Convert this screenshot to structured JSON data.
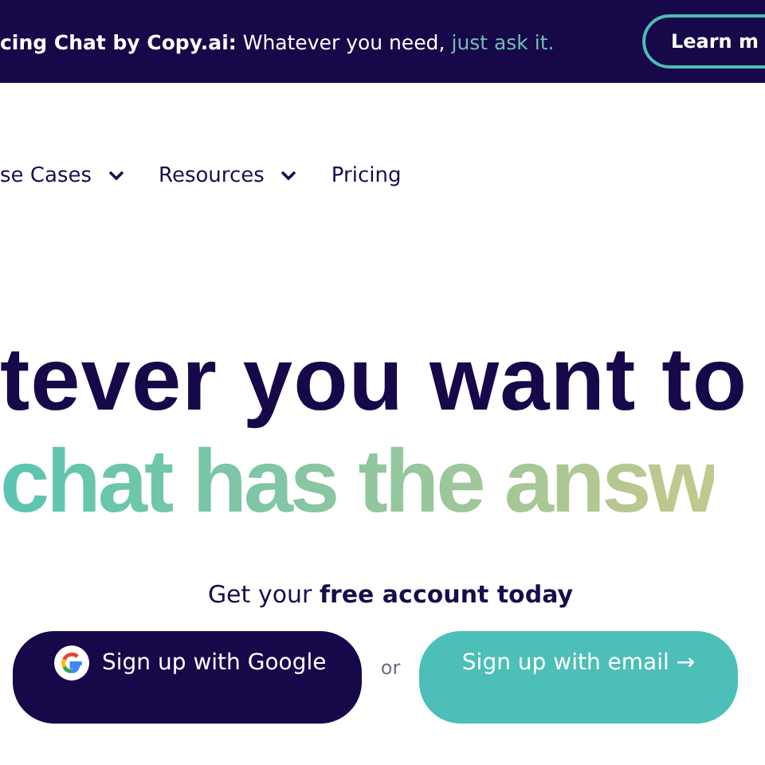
{
  "banner": {
    "text": "**cing Chat by Copy.ai:** Whatever you need,",
    "highlight": "just ask it.",
    "button": "Learn m"
  },
  "nav": [
    {
      "label": "se Cases",
      "has_dropdown": true
    },
    {
      "label": "Resources",
      "has_dropdown": true
    },
    {
      "label": "Pricing",
      "has_dropdown": false
    }
  ],
  "hero": {
    "line_1": "tever you want to",
    "line_2": "chat has the answ"
  },
  "cta": {
    "prompt": "Get your **free account today**",
    "google_button": "Sign up with Google",
    "separator": "or",
    "email_button": "Sign up with email",
    "email_arrow": "→"
  }
}
